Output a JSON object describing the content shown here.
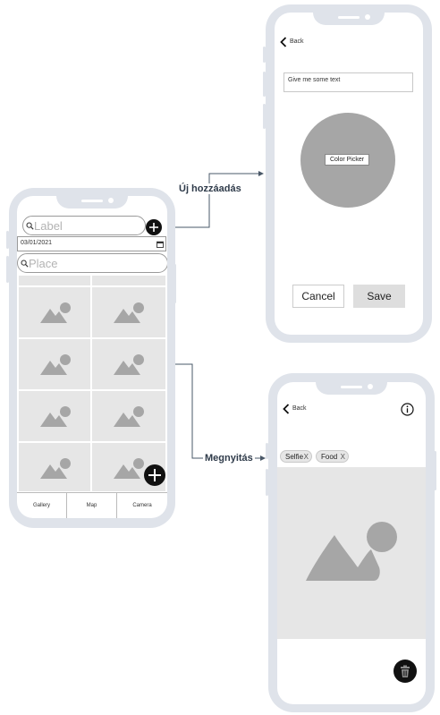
{
  "flow": {
    "add_label": "Új hozzáadás",
    "open_label": "Megnyitás"
  },
  "gallery": {
    "label_placeholder": "Label",
    "date_value": "03/01/2021",
    "place_placeholder": "Place",
    "tabs": [
      "Gallery",
      "Map",
      "Camera"
    ]
  },
  "add_screen": {
    "back_label": "Back",
    "text_placeholder": "Give me some text",
    "color_picker_label": "Color Picker",
    "cancel_label": "Cancel",
    "save_label": "Save"
  },
  "detail_screen": {
    "back_label": "Back",
    "tags": [
      "Selfie",
      "Food"
    ],
    "tag_remove": "X"
  },
  "colors": {
    "phone_frame": "#dfe3ea",
    "placeholder_gray": "#b3b3b3",
    "tile_bg": "#e6e6e6",
    "icon_gray": "#a6a6a6",
    "connector": "#4a5868",
    "fab": "#111111"
  }
}
